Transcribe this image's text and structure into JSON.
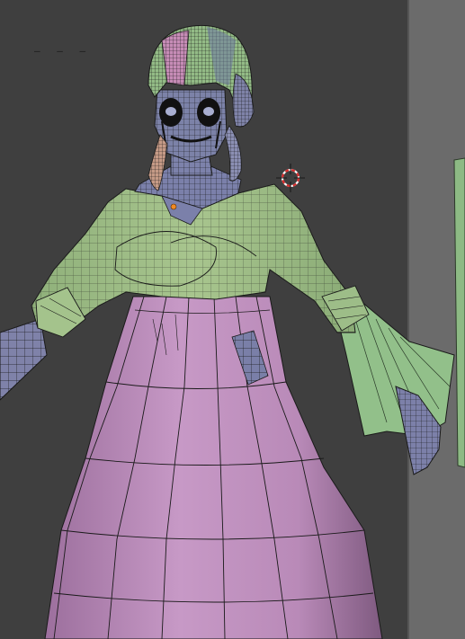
{
  "viewport": {
    "label": "– –  –",
    "cursor": "3d-cursor-icon",
    "origin": "object-origin-icon"
  },
  "colors": {
    "background": "#3f3f3f",
    "side_panel": "#6b6b6b",
    "top_mesh": "#9fc285",
    "skirt_mesh": "#c294c1",
    "skin_mesh": "#7d82ab",
    "hair_mesh": "#90b885",
    "hair_pink": "#c58ab5",
    "wire": "#1a1a1a"
  },
  "objects": [
    "hair",
    "face",
    "blouse",
    "skirt",
    "arm-left",
    "arm-right",
    "hand",
    "ribbon-left",
    "ribbon-right"
  ]
}
